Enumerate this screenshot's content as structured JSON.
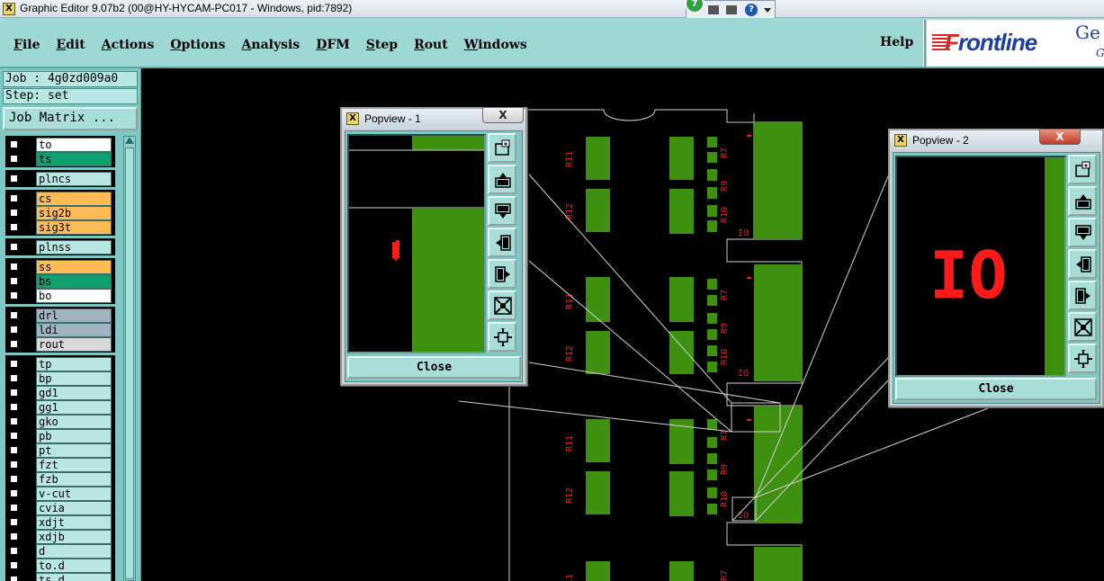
{
  "window": {
    "title": "Graphic Editor 9.07b2 (00@HY-HYCAM-PC017 - Windows, pid:7892)",
    "app_icon_letter": "X"
  },
  "tray": {
    "badge_number": "7",
    "help_symbol": "?"
  },
  "menubar": {
    "items": [
      "File",
      "Edit",
      "Actions",
      "Options",
      "Analysis",
      "DFM",
      "Step",
      "Rout",
      "Windows"
    ],
    "help": "Help"
  },
  "logo": {
    "brand": "Frontline",
    "cut_text": "Ge",
    "cut_text_2": "G"
  },
  "left_panel": {
    "job": "Job : 4g0zd009a0",
    "step": "Step: set",
    "job_matrix": "Job Matrix ...",
    "layers": [
      {
        "name": "to",
        "color": "#ffffff"
      },
      {
        "name": "ts",
        "color": "#10a070"
      },
      {
        "name": "plncs",
        "color": "#b8e6e2"
      },
      {
        "name": "cs",
        "color": "#ffbb55"
      },
      {
        "name": "sig2b",
        "color": "#ffbb55"
      },
      {
        "name": "sig3t",
        "color": "#ffbb55"
      },
      {
        "name": "plnss",
        "color": "#b8e6e2"
      },
      {
        "name": "ss",
        "color": "#ffbb55"
      },
      {
        "name": "bs",
        "color": "#10a070"
      },
      {
        "name": "bo",
        "color": "#ffffff"
      },
      {
        "name": "drl",
        "color": "#9fb4bf"
      },
      {
        "name": "ldi",
        "color": "#9fb4bf"
      },
      {
        "name": "rout",
        "color": "#d9d9d9"
      },
      {
        "name": "tp",
        "color": "#b8e6e2"
      },
      {
        "name": "bp",
        "color": "#b8e6e2"
      },
      {
        "name": "gd1",
        "color": "#b8e6e2"
      },
      {
        "name": "gg1",
        "color": "#b8e6e2"
      },
      {
        "name": "gko",
        "color": "#b8e6e2"
      },
      {
        "name": "pb",
        "color": "#b8e6e2"
      },
      {
        "name": "pt",
        "color": "#b8e6e2"
      },
      {
        "name": "fzt",
        "color": "#b8e6e2"
      },
      {
        "name": "fzb",
        "color": "#b8e6e2"
      },
      {
        "name": "v-cut",
        "color": "#b8e6e2"
      },
      {
        "name": "cvia",
        "color": "#b8e6e2"
      },
      {
        "name": "xdjt",
        "color": "#b8e6e2"
      },
      {
        "name": "xdjb",
        "color": "#b8e6e2"
      },
      {
        "name": "d",
        "color": "#b8e6e2"
      },
      {
        "name": "to.d",
        "color": "#b8e6e2"
      },
      {
        "name": "ts.d",
        "color": "#b8e6e2"
      }
    ]
  },
  "board_labels": {
    "r11": "R11",
    "r12": "R12",
    "r7": "R7",
    "r9": "R9",
    "r10": "R10",
    "io": "IO"
  },
  "popview1": {
    "title": "Popview - 1",
    "close_label": "Close",
    "close_x": "X"
  },
  "popview2": {
    "title": "Popview - 2",
    "close_label": "Close",
    "close_x": "X",
    "zoom_text": "IO"
  },
  "colors": {
    "copper": "#3f8f10",
    "silkscreen": "#ff1a1a",
    "panel": "#7ec7c2",
    "menubar": "#9ed8d4"
  },
  "popview_tools": [
    "zoom-fit-icon",
    "pan-up-icon",
    "pan-down-icon",
    "pan-left-icon",
    "pan-right-icon",
    "zoom-out-icon",
    "zoom-in-icon"
  ]
}
